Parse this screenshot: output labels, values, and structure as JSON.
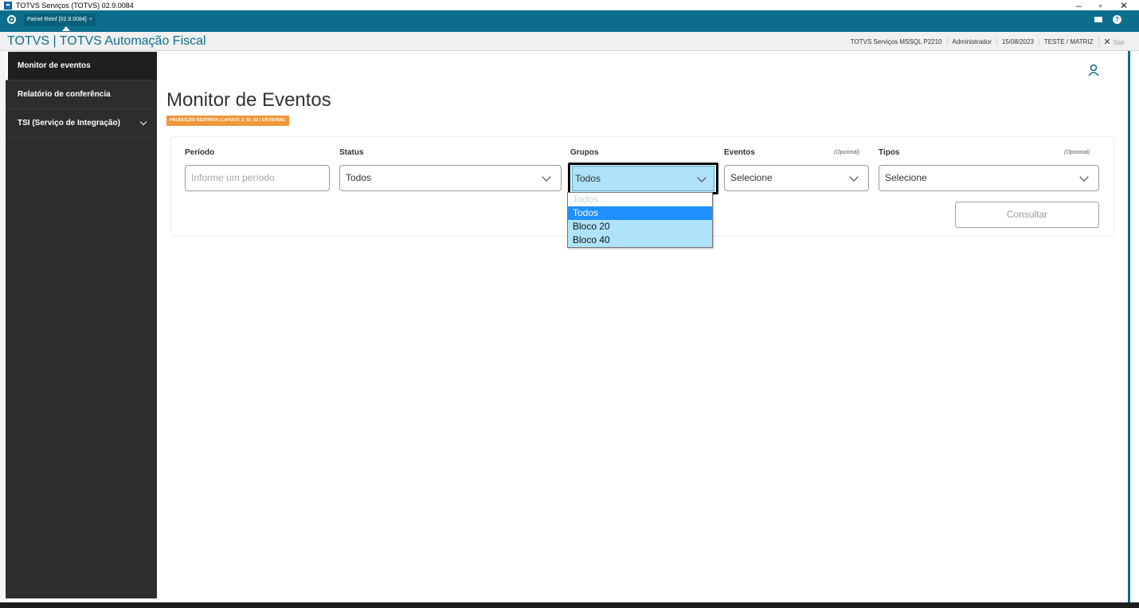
{
  "window": {
    "title": "TOTVS Serviços (TOTVS) 02.9.0084",
    "controls": [
      "–",
      "▫",
      "✕"
    ]
  },
  "tabstrip": {
    "tab_label": "Painel Reinf [02.9.0084]",
    "tab_close": "×"
  },
  "header": {
    "brand": "TOTVS | TOTVS Automação Fiscal",
    "environment": "TOTVS Serviços MSSQL P2210",
    "user": "Administrador",
    "date": "15/08/2023",
    "company": "TESTE / MATRIZ",
    "logout_icon": "✕",
    "logout": "Sair"
  },
  "sidebar": {
    "items": [
      {
        "label": "Monitor de eventos"
      },
      {
        "label": "Relatório de conferência"
      },
      {
        "label": "TSI (Serviço de Integração)"
      }
    ]
  },
  "main": {
    "title": "Monitor de Eventos",
    "badge": "PRODUÇÃO RESTRITA | LAYOUT: 2_01_02 | ENTIDADE:",
    "filters": {
      "periodo_label": "Período",
      "periodo_placeholder": "Informe um período",
      "status_label": "Status",
      "status_value": "Todos",
      "grupos_label": "Grupos",
      "grupos_value": "Todos",
      "eventos_label": "Eventos",
      "eventos_optional": "(Opcional)",
      "eventos_value": "Selecione",
      "tipos_label": "Tipos",
      "tipos_optional": "(Opcional)",
      "tipos_value": "Selecione",
      "consultar": "Consultar"
    },
    "grupos_options": [
      "Todos",
      "Todos",
      "Bloco 20",
      "Bloco 40"
    ]
  },
  "colors": {
    "teal": "#0c6e8c",
    "badge": "#f0973a",
    "sidebar": "#2d2d2d",
    "selected": "#1e90ff"
  }
}
